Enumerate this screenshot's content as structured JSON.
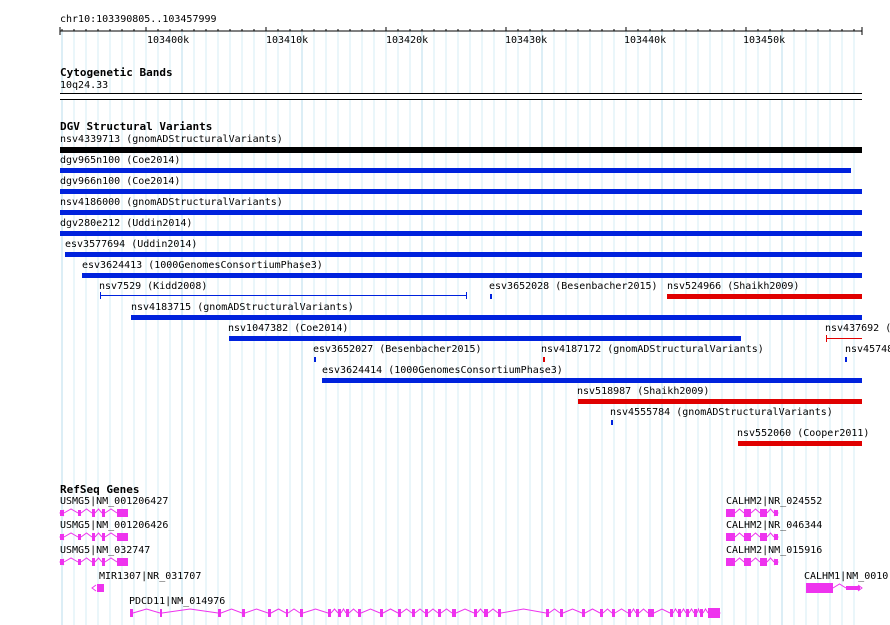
{
  "view": {
    "location": "chr10:103390805..103457999",
    "ruler_ticks": [
      "103400k",
      "103410k",
      "103420k",
      "103430k",
      "103440k",
      "103450k"
    ]
  },
  "cytoband": {
    "title": "Cytogenetic Bands",
    "band": "10q24.33"
  },
  "dgv": {
    "title": "DGV Structural Variants",
    "features": [
      {
        "label": "nsv4339713 (gnomADStructuralVariants)",
        "color": "#000000"
      },
      {
        "label": "dgv965n100 (Coe2014)",
        "color": "#0022dd"
      },
      {
        "label": "dgv966n100 (Coe2014)",
        "color": "#0022dd"
      },
      {
        "label": "nsv4186000 (gnomADStructuralVariants)",
        "color": "#0022dd"
      },
      {
        "label": "dgv280e212 (Uddin2014)",
        "color": "#0022dd"
      },
      {
        "label": "esv3577694 (Uddin2014)",
        "color": "#0022dd"
      },
      {
        "label": "esv3624413 (1000GenomesConsortiumPhase3)",
        "color": "#0022dd"
      },
      {
        "label": "nsv7529 (Kidd2008)",
        "color": "#0022dd"
      },
      {
        "label": "esv3652028 (Besenbacher2015)",
        "color": "#0022dd"
      },
      {
        "label": "nsv524966 (Shaikh2009)",
        "color": "#e00000"
      },
      {
        "label": "nsv4183715 (gnomADStructuralVariants)",
        "color": "#0022dd"
      },
      {
        "label": "nsv1047382 (Coe2014)",
        "color": "#0022dd"
      },
      {
        "label": "nsv437692 (",
        "color": "#e00000"
      },
      {
        "label": "esv3652027 (Besenbacher2015)",
        "color": "#0022dd"
      },
      {
        "label": "nsv4187172 (gnomADStructuralVariants)",
        "color": "#e00000"
      },
      {
        "label": "nsv45748",
        "color": "#0022dd"
      },
      {
        "label": "esv3624414 (1000GenomesConsortiumPhase3)",
        "color": "#0022dd"
      },
      {
        "label": "nsv518987 (Shaikh2009)",
        "color": "#e00000"
      },
      {
        "label": "nsv4555784 (gnomADStructuralVariants)",
        "color": "#0022dd"
      },
      {
        "label": "nsv552060 (Cooper2011)",
        "color": "#e00000"
      }
    ]
  },
  "refseq": {
    "title": "RefSeq Genes",
    "color": "#ee33ee",
    "genes": [
      {
        "label": "USMG5|NM_001206427"
      },
      {
        "label": "USMG5|NM_001206426"
      },
      {
        "label": "USMG5|NM_032747"
      },
      {
        "label": "MIR1307|NR_031707"
      },
      {
        "label": "PDCD11|NM_014976"
      },
      {
        "label": "CALHM2|NR_024552"
      },
      {
        "label": "CALHM2|NR_046344"
      },
      {
        "label": "CALHM2|NM_015916"
      },
      {
        "label": "CALHM1|NM_0010"
      }
    ]
  }
}
